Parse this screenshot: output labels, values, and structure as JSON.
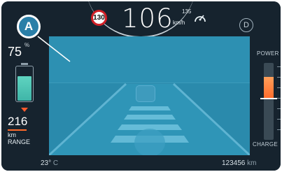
{
  "top": {
    "speed_limit": "130",
    "speed": "106",
    "speed_unit": "km/h",
    "cruise_speed": "135",
    "gear": "D"
  },
  "badge": {
    "letter": "A"
  },
  "battery": {
    "percent": "75",
    "percent_sign": "%",
    "level": 0.75,
    "color": "#4fc9b8"
  },
  "range": {
    "value": "216",
    "unit": "km",
    "label": "RANGE"
  },
  "power_gauge": {
    "top_label": "POWER",
    "bottom_label": "CHARGE",
    "accent": "#ff6a2a"
  },
  "bottom": {
    "temperature": "23°",
    "temperature_unit": "C",
    "odometer": "123456",
    "odometer_unit": "km"
  },
  "icons": {
    "cruise": "cruise-control-icon",
    "battery": "battery-icon",
    "range_arrow": "range-indicator-icon",
    "car": "lead-vehicle-icon"
  }
}
